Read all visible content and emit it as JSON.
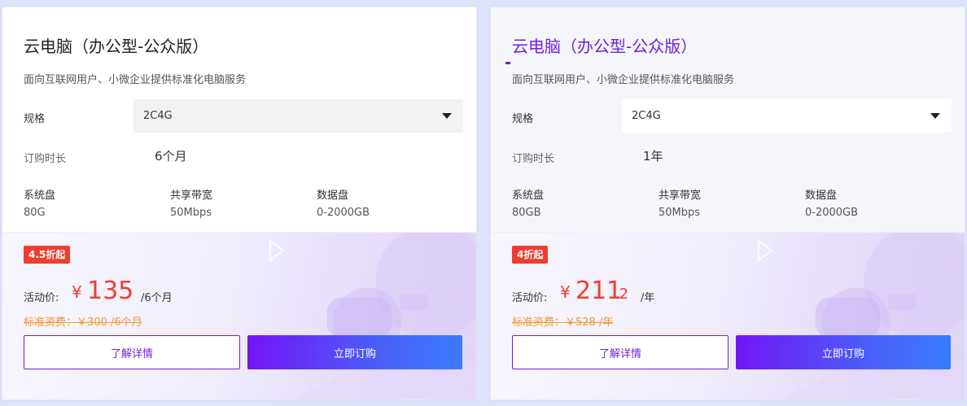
{
  "colors": {
    "accent": "#6e1fe0",
    "price_red": "#ef3d2f",
    "orig_orange": "#f29b36",
    "buy_gradient_start": "#7414f5",
    "buy_gradient_end": "#3a7bfd"
  },
  "cards": [
    {
      "title": "云电脑（办公型-公众版）",
      "subtitle": "面向互联网用户、小微企业提供标准化电脑服务",
      "spec_label": "规格",
      "spec_value": "2C4G",
      "duration_label": "订购时长",
      "duration_value": "6个月",
      "attrs": [
        {
          "label": "系统盘",
          "value": "80G"
        },
        {
          "label": "共享带宽",
          "value": "50Mbps"
        },
        {
          "label": "数据盘",
          "value": "0-2000GB"
        }
      ],
      "badge": "4.5折起",
      "price_label": "活动价:",
      "currency": "¥",
      "price_int": "135",
      "price_dec": "",
      "price_unit": "/6个月",
      "orig_price": "标准资费：￥300 /6个月",
      "detail_label": "了解详情",
      "buy_label": "立即订购"
    },
    {
      "title": "云电脑（办公型-公众版）",
      "subtitle": "面向互联网用户、小微企业提供标准化电脑服务",
      "spec_label": "规格",
      "spec_value": "2C4G",
      "duration_label": "订购时长",
      "duration_value": "1年",
      "attrs": [
        {
          "label": "系统盘",
          "value": "80GB"
        },
        {
          "label": "共享带宽",
          "value": "50Mbps"
        },
        {
          "label": "数据盘",
          "value": "0-2000GB"
        }
      ],
      "badge": "4折起",
      "price_label": "活动价:",
      "currency": "¥",
      "price_int": "211",
      "price_dec": ".2",
      "price_unit": "/年",
      "orig_price": "标准资费：￥528 /年",
      "detail_label": "了解详情",
      "buy_label": "立即订购"
    }
  ]
}
